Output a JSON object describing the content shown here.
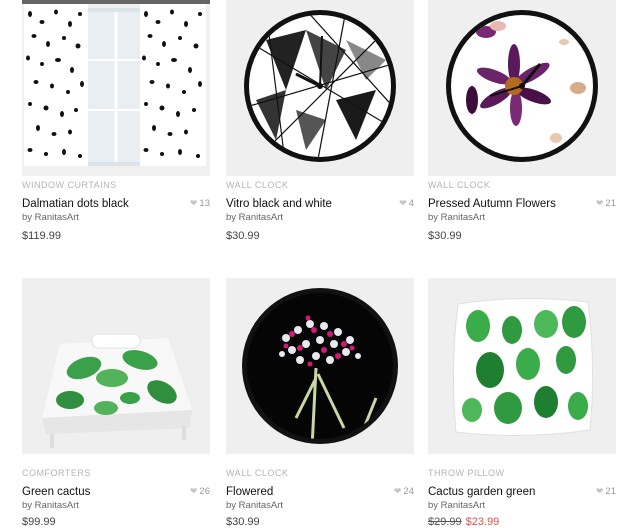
{
  "products": [
    {
      "category": "WINDOW CURTAINS",
      "title": "Dalmatian dots black",
      "by": "by RanitasArt",
      "price": "$119.99",
      "likes": "13",
      "image": "dalmatian-dots-curtains"
    },
    {
      "category": "WALL CLOCK",
      "title": "Vitro black and white",
      "by": "by RanitasArt",
      "price": "$30.99",
      "likes": "4",
      "image": "geometric-black-white-clock"
    },
    {
      "category": "WALL CLOCK",
      "title": "Pressed Autumn Flowers",
      "by": "by RanitasArt",
      "price": "$30.99",
      "likes": "21",
      "image": "pressed-flowers-clock"
    },
    {
      "category": "COMFORTERS",
      "title": "Green cactus",
      "by": "by RanitasArt",
      "price": "$99.99",
      "likes": "26",
      "image": "green-cactus-comforter"
    },
    {
      "category": "WALL CLOCK",
      "title": "Flowered",
      "by": "by RanitasArt",
      "price": "$30.99",
      "likes": "24",
      "image": "pink-flower-tree-clock"
    },
    {
      "category": "THROW PILLOW",
      "title": "Cactus garden green",
      "by": "by RanitasArt",
      "price_old": "$29.99",
      "price_sale": "$23.99",
      "likes": "21",
      "image": "cactus-garden-pillow"
    }
  ],
  "icons": {
    "like": "heart-icon"
  },
  "colors": {
    "sale": "#e0504a",
    "category": "#b4b4b4",
    "tile_bg": "#efefef"
  }
}
